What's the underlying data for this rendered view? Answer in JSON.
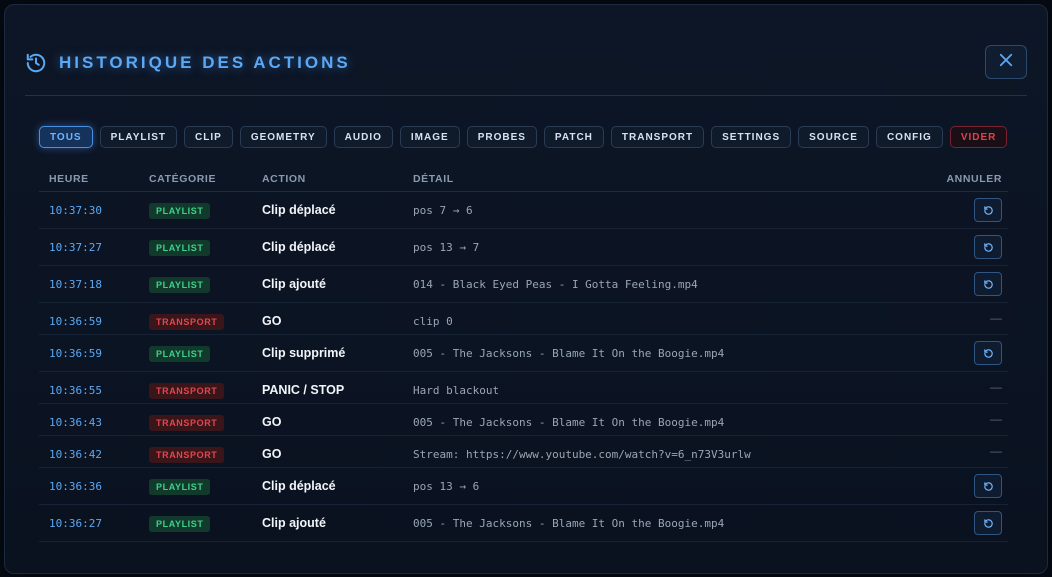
{
  "header": {
    "title": "HISTORIQUE DES ACTIONS",
    "title_icon": "history-icon",
    "close_icon": "close-icon"
  },
  "colors": {
    "accent": "#5ba8f5",
    "playlist_bg": "#123a2c",
    "playlist_fg": "#3fd08a",
    "transport_bg": "#3a1519",
    "transport_fg": "#e0474f",
    "danger": "#e2414f"
  },
  "filters": [
    {
      "label": "TOUS",
      "state": "active"
    },
    {
      "label": "PLAYLIST"
    },
    {
      "label": "CLIP"
    },
    {
      "label": "GEOMETRY"
    },
    {
      "label": "AUDIO"
    },
    {
      "label": "IMAGE"
    },
    {
      "label": "PROBES"
    },
    {
      "label": "PATCH"
    },
    {
      "label": "TRANSPORT"
    },
    {
      "label": "SETTINGS"
    },
    {
      "label": "SOURCE"
    },
    {
      "label": "CONFIG"
    },
    {
      "label": "VIDER",
      "state": "danger"
    }
  ],
  "table": {
    "columns": {
      "time": "HEURE",
      "category": "CATÉGORIE",
      "action": "ACTION",
      "detail": "DÉTAIL",
      "undo": "ANNULER"
    },
    "rows": [
      {
        "time": "10:37:30",
        "category": "PLAYLIST",
        "action": "Clip déplacé",
        "detail": "pos 7 → 6",
        "undo": true
      },
      {
        "time": "10:37:27",
        "category": "PLAYLIST",
        "action": "Clip déplacé",
        "detail": "pos 13 → 7",
        "undo": true
      },
      {
        "time": "10:37:18",
        "category": "PLAYLIST",
        "action": "Clip ajouté",
        "detail": "014 - Black Eyed Peas - I Gotta Feeling.mp4",
        "undo": true
      },
      {
        "time": "10:36:59",
        "category": "TRANSPORT",
        "action": "GO",
        "detail": "clip 0",
        "undo": false,
        "undo_text": "—"
      },
      {
        "time": "10:36:59",
        "category": "PLAYLIST",
        "action": "Clip supprimé",
        "detail": "005 - The Jacksons - Blame It On the Boogie.mp4",
        "undo": true
      },
      {
        "time": "10:36:55",
        "category": "TRANSPORT",
        "action": "PANIC / STOP",
        "detail": "Hard blackout",
        "undo": false,
        "undo_text": "—"
      },
      {
        "time": "10:36:43",
        "category": "TRANSPORT",
        "action": "GO",
        "detail": "005 - The Jacksons - Blame It On the Boogie.mp4",
        "undo": false,
        "undo_text": "—"
      },
      {
        "time": "10:36:42",
        "category": "TRANSPORT",
        "action": "GO",
        "detail": "Stream: https://www.youtube.com/watch?v=6_n73V3urlw",
        "undo": false,
        "undo_text": "—"
      },
      {
        "time": "10:36:36",
        "category": "PLAYLIST",
        "action": "Clip déplacé",
        "detail": "pos 13 → 6",
        "undo": true
      },
      {
        "time": "10:36:27",
        "category": "PLAYLIST",
        "action": "Clip ajouté",
        "detail": "005 - The Jacksons - Blame It On the Boogie.mp4",
        "undo": true
      }
    ],
    "undo_icon": "undo-icon"
  }
}
